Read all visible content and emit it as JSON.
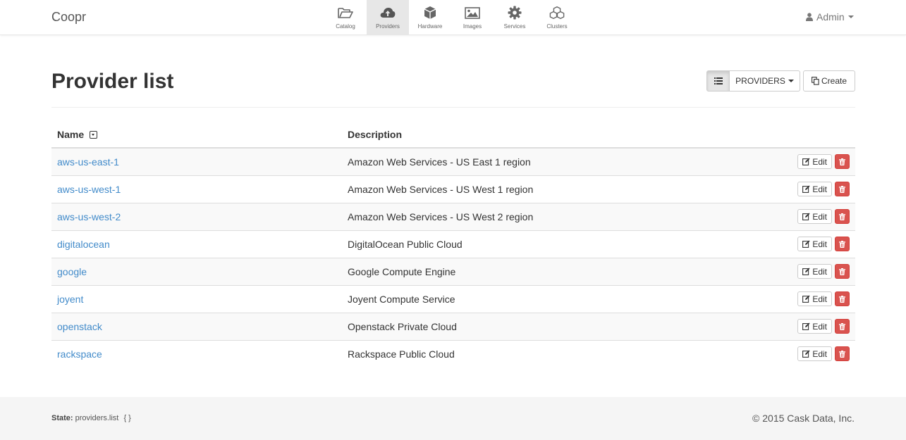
{
  "brand": "Coopr",
  "nav": [
    {
      "label": "Catalog",
      "icon": "folder-open-icon"
    },
    {
      "label": "Providers",
      "icon": "cloud-upload-icon",
      "active": true
    },
    {
      "label": "Hardware",
      "icon": "cube-icon"
    },
    {
      "label": "Images",
      "icon": "picture-icon"
    },
    {
      "label": "Services",
      "icon": "cog-icon"
    },
    {
      "label": "Clusters",
      "icon": "cubes-icon"
    }
  ],
  "user": {
    "name": "Admin",
    "icon": "user-icon"
  },
  "page": {
    "title": "Provider list",
    "view_toggle_icon": "list-icon",
    "dropdown_label": "PROVIDERS",
    "create_label": "Create"
  },
  "table": {
    "columns": [
      "Name",
      "Description"
    ],
    "rows": [
      {
        "name": "aws-us-east-1",
        "description": "Amazon Web Services - US East 1 region"
      },
      {
        "name": "aws-us-west-1",
        "description": "Amazon Web Services - US West 1 region"
      },
      {
        "name": "aws-us-west-2",
        "description": "Amazon Web Services - US West 2 region"
      },
      {
        "name": "digitalocean",
        "description": "DigitalOcean Public Cloud"
      },
      {
        "name": "google",
        "description": "Google Compute Engine"
      },
      {
        "name": "joyent",
        "description": "Joyent Compute Service"
      },
      {
        "name": "openstack",
        "description": "Openstack Private Cloud"
      },
      {
        "name": "rackspace",
        "description": "Rackspace Public Cloud"
      }
    ],
    "edit_label": "Edit"
  },
  "footer": {
    "state_label": "State:",
    "state_value": "providers.list",
    "state_braces": "{ }",
    "copyright": "© 2015 Cask Data, Inc."
  },
  "colors": {
    "link": "#428bca",
    "danger": "#d9534f",
    "nav_active": "#e7e7e7"
  }
}
